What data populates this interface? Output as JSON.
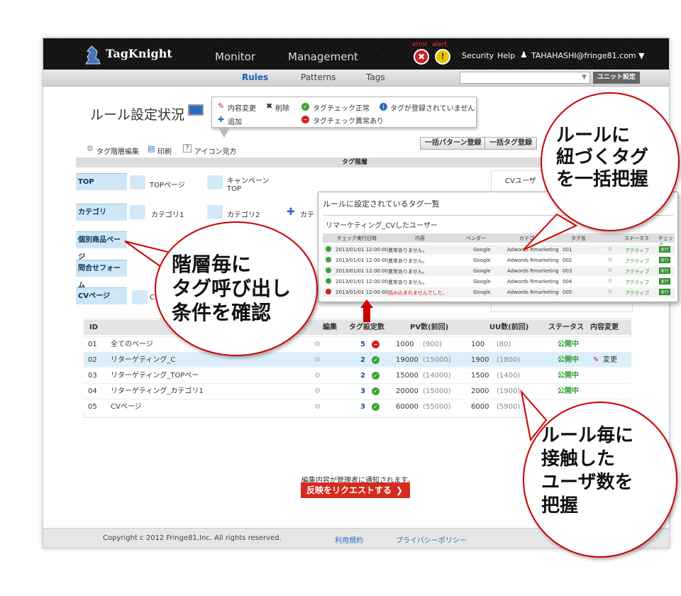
{
  "header": {
    "logo": "TagKnight",
    "nav": [
      "Monitor",
      "Management"
    ],
    "error_label": "error",
    "alert_label": "alert",
    "security": "Security",
    "help": "Help",
    "user": "TAHAHASHI@fringe81.com ▼"
  },
  "subnav": {
    "tabs": [
      "Rules",
      "Patterns",
      "Tags"
    ],
    "unit_button": "ユニット設定"
  },
  "page": {
    "title": "ルール設定状況"
  },
  "legend": {
    "edit": "内容変更",
    "delete": "削除",
    "add": "追加",
    "ok": "タグチェック正常",
    "ng": "タグチェック異常あり",
    "none": "タグが登録されていません"
  },
  "toolbar": {
    "tree_edit": "タグ階層編集",
    "print": "印刷",
    "icons": "アイコン見方",
    "bulk_pattern": "一括パターン登録",
    "bulk_tag": "一括タグ登録"
  },
  "tree": {
    "header": "タグ階層",
    "levels": [
      "TOP",
      "カテゴリ",
      "個別商品ページ",
      "問合せフォーム",
      "CVページ"
    ],
    "top_items": [
      "TOPページ",
      "キャンペーンTOP"
    ],
    "cat_items": [
      "カテゴリ1",
      "カテゴリ2",
      "カテ"
    ],
    "cv_user": "CVユーザ",
    "cv_trunc": "C"
  },
  "popup": {
    "title": "ルールに設定されているタグ一覧",
    "subtitle": "リマーケティング_CVしたユーザー",
    "columns": [
      "チェック実行日時",
      "内容",
      "ベンダー",
      "カテゴリ",
      "タグ名",
      "",
      "ステータス",
      "チェック"
    ],
    "rows": [
      {
        "date": "2013/01/01 12:00:00",
        "content": "異常ありません。",
        "vendor": "Google",
        "category": "Adwords Rmarketing",
        "tag": "001",
        "status": "アクティブ",
        "check": "実行"
      },
      {
        "date": "2013/01/01 12:00:00",
        "content": "異常ありません。",
        "vendor": "Google",
        "category": "Adwords Rmarketing",
        "tag": "002",
        "status": "アクティブ",
        "check": "実行"
      },
      {
        "date": "2013/01/01 12:00:00",
        "content": "異常ありません。",
        "vendor": "Google",
        "category": "Adwords Rmarketing",
        "tag": "003",
        "status": "アクティブ",
        "check": "実行"
      },
      {
        "date": "2013/01/01 12:00:00",
        "content": "異常ありません。",
        "vendor": "Google",
        "category": "Adwords Rmarketing",
        "tag": "004",
        "status": "アクティブ",
        "check": "実行"
      },
      {
        "date": "2013/01/01 12:00:00",
        "content": "読み込まれませんでした。",
        "vendor": "Google",
        "category": "Adwords Rmarketing",
        "tag": "005",
        "status": "アクティブ",
        "check": "実行"
      }
    ]
  },
  "table": {
    "columns": [
      "ID",
      "",
      "編集",
      "タグ設定数",
      "PV数(前回)",
      "UU数(前回)",
      "ステータス",
      "内容変更"
    ],
    "rows": [
      {
        "id": "01",
        "name": "全てのページ",
        "count": "5",
        "pv": "1000",
        "pv_prev": "(900)",
        "uu": "100",
        "uu_prev": "(80)",
        "status": "公開中",
        "change": ""
      },
      {
        "id": "02",
        "name": "リターゲティング_C",
        "count": "2",
        "pv": "19000",
        "pv_prev": "(15000)",
        "uu": "1900",
        "uu_prev": "(1800)",
        "status": "公開中",
        "change": "変更"
      },
      {
        "id": "03",
        "name": "リターゲティング_TOPペー",
        "count": "2",
        "pv": "15000",
        "pv_prev": "(14000)",
        "uu": "1500",
        "uu_prev": "(1400)",
        "status": "公開中",
        "change": ""
      },
      {
        "id": "04",
        "name": "リターゲティング_カテゴリ1",
        "count": "3",
        "pv": "20000",
        "pv_prev": "(15000)",
        "uu": "2000",
        "uu_prev": "(1900)",
        "status": "公開中",
        "change": ""
      },
      {
        "id": "05",
        "name": "CVページ",
        "count": "3",
        "pv": "60000",
        "pv_prev": "(55000)",
        "uu": "6000",
        "uu_prev": "(5900)",
        "status": "",
        "change": ""
      }
    ]
  },
  "notice": "編集内容が管理者に通知されます。",
  "request_button": "反映をリクエストする",
  "footer": {
    "copyright": "Copyright c 2012 Fringe81,Inc. All rights reserved.",
    "terms": "利用規約",
    "privacy": "プライバシーポリシー"
  },
  "callouts": {
    "top_right": [
      "ルールに",
      "紐づくタグ",
      "を一括把握"
    ],
    "left": [
      "階層毎に",
      "タグ呼び出し",
      "条件を確認"
    ],
    "bottom_right": [
      "ルール毎に",
      "接触した",
      "ユーザ数を",
      "把握"
    ]
  }
}
